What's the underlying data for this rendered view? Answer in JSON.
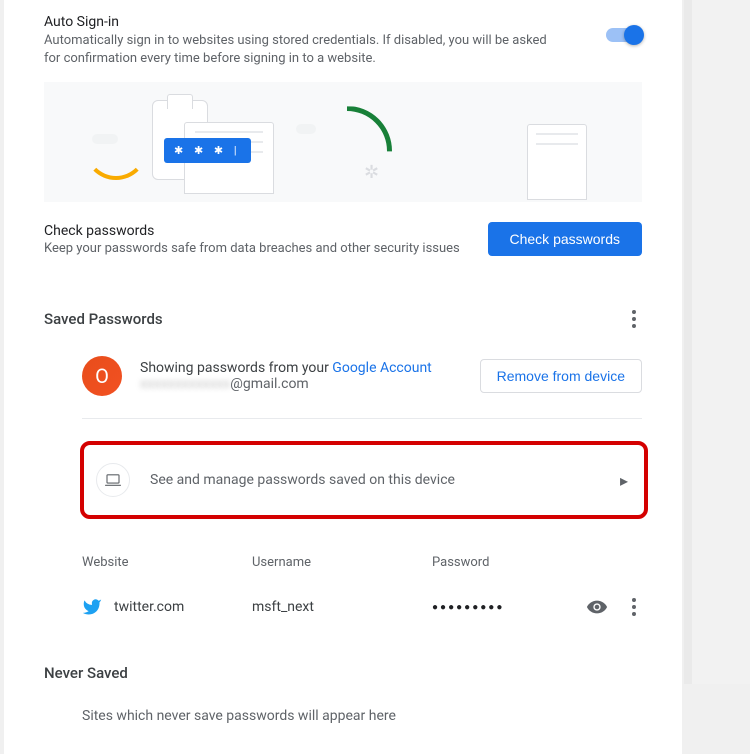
{
  "autoSignin": {
    "title": "Auto Sign-in",
    "desc": "Automatically sign in to websites using stored credentials. If disabled, you will be asked for confirmation every time before signing in to a website."
  },
  "banner": {
    "chip": "✱ ✱ ✱ |"
  },
  "check": {
    "title": "Check passwords",
    "desc": "Keep your passwords safe from data breaches and other security issues",
    "button": "Check passwords"
  },
  "saved": {
    "heading": "Saved Passwords",
    "avatarLetter": "O",
    "showingPrefix": "Showing passwords from your ",
    "googleAccount": "Google Account",
    "emailHidden": "xxxxxxxxxxxxx",
    "emailDomain": "@gmail.com",
    "removeBtn": "Remove from device"
  },
  "deviceRow": {
    "label": "See and manage passwords saved on this device"
  },
  "tableHead": {
    "website": "Website",
    "username": "Username",
    "password": "Password"
  },
  "entry": {
    "site": "twitter.com",
    "user": "msft_next",
    "pass": "●●●●●●●●●"
  },
  "never": {
    "heading": "Never Saved",
    "text": "Sites which never save passwords will appear here"
  }
}
